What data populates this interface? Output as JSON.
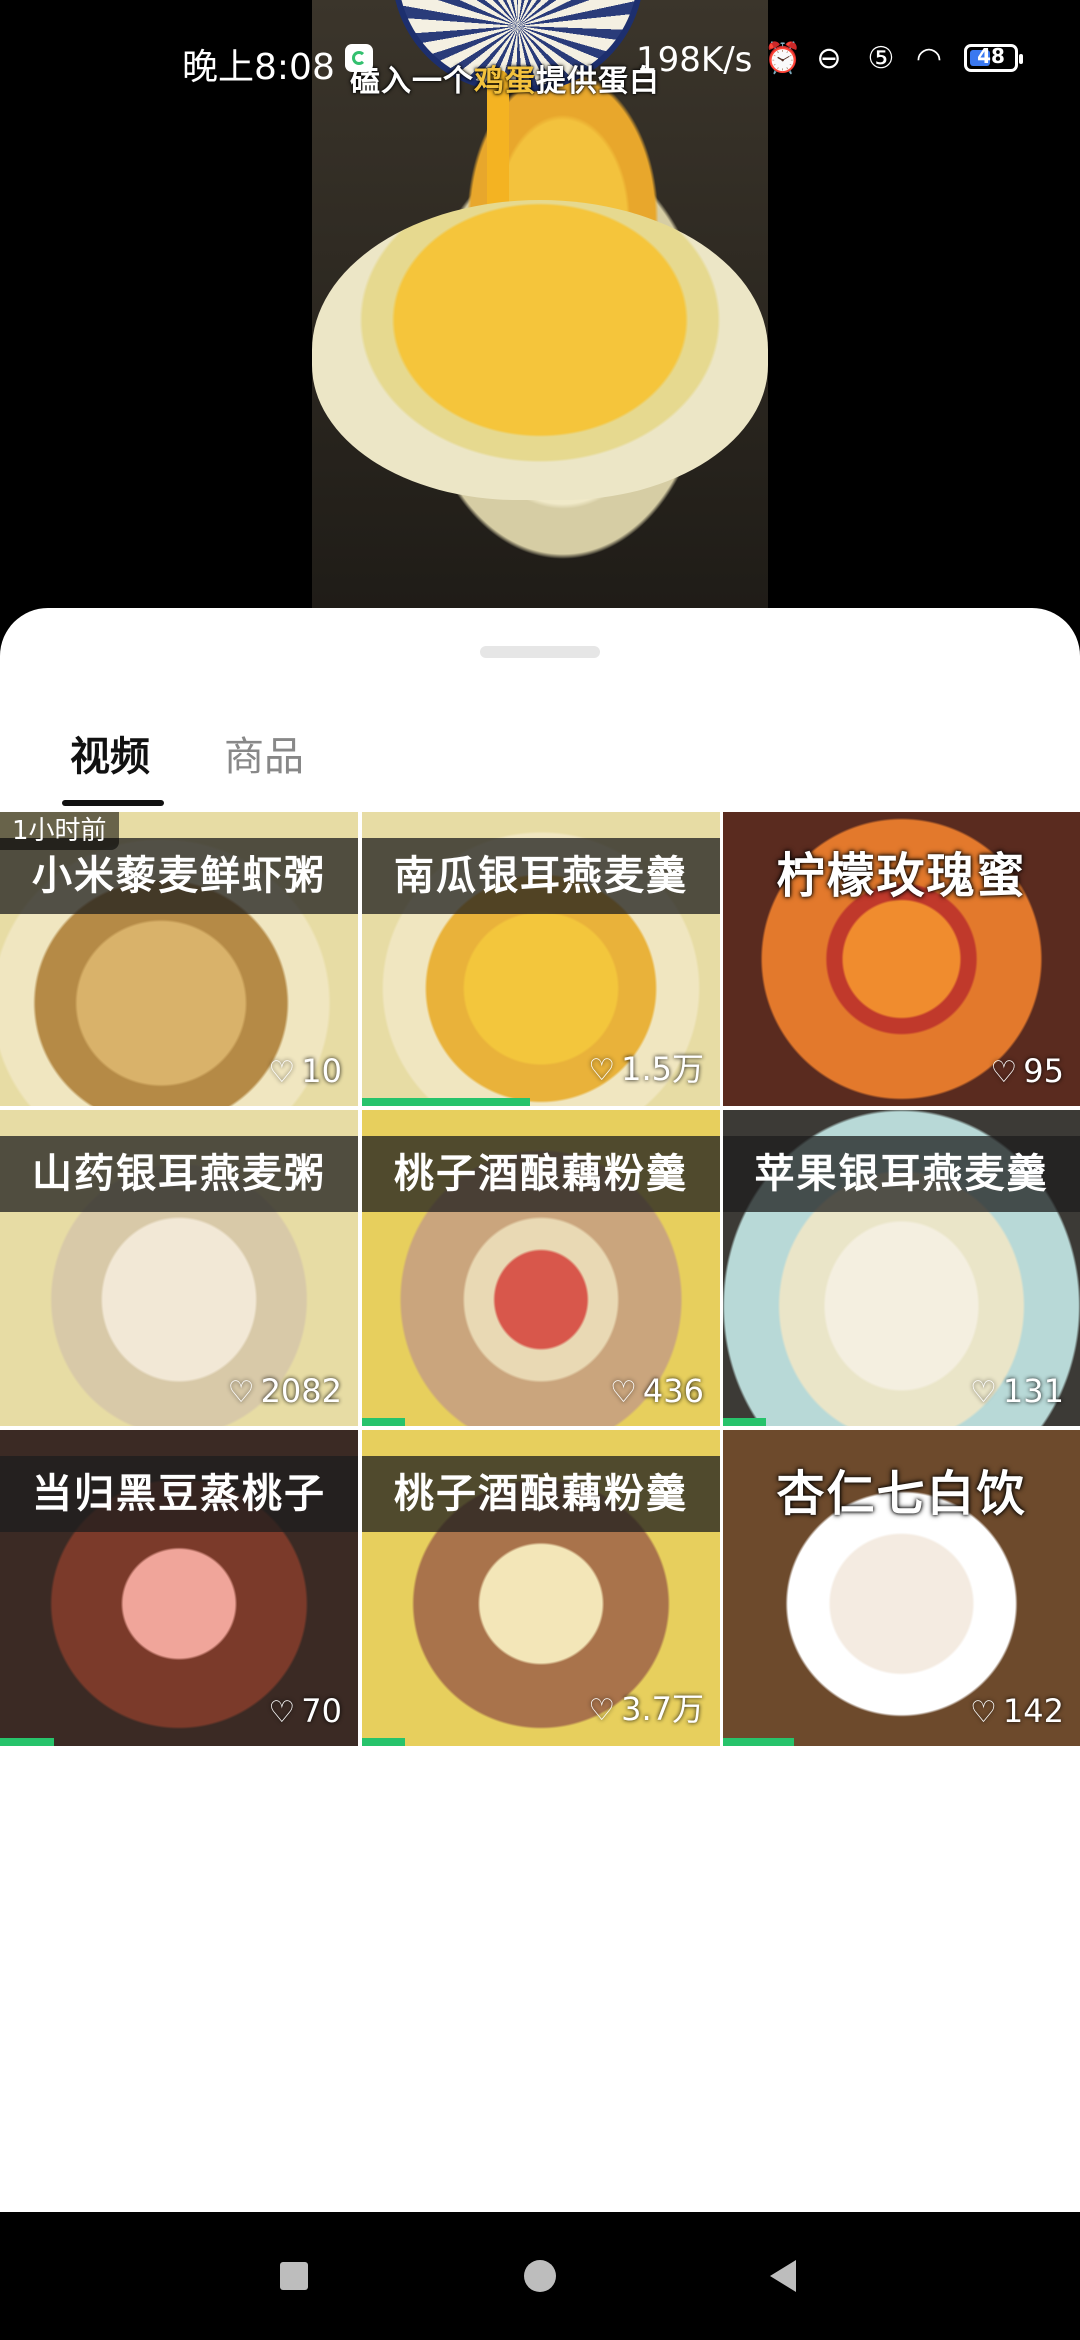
{
  "status_bar": {
    "time": "晚上8:08",
    "speed": "198K/s",
    "battery": "48",
    "icons": [
      "alarm-icon",
      "dnd-icon",
      "vpn-icon",
      "wifi-icon",
      "battery-icon"
    ]
  },
  "video": {
    "caption_prefix": "磕入一个",
    "caption_highlight": "鸡蛋",
    "caption_suffix": "提供蛋白"
  },
  "tabs": [
    {
      "label": "视频",
      "active": true
    },
    {
      "label": "商品",
      "active": false
    }
  ],
  "cards": [
    {
      "title": "小米藜麦鲜虾粥",
      "likes": "10",
      "badge": "1小时前",
      "progress": 0
    },
    {
      "title": "南瓜银耳燕麦羹",
      "likes": "1.5万",
      "progress": 0.47
    },
    {
      "title": "柠檬玫瑰蜜",
      "likes": "95",
      "progress": 0
    },
    {
      "title": "山药银耳燕麦粥",
      "likes": "2082",
      "progress": 0
    },
    {
      "title": "桃子酒酿藕粉羹",
      "likes": "436",
      "progress": 0.12
    },
    {
      "title": "苹果银耳燕麦羹",
      "likes": "131",
      "progress": 0.12
    },
    {
      "title": "当归黑豆蒸桃子",
      "likes": "70",
      "progress": 0.15
    },
    {
      "title": "桃子酒酿藕粉羹",
      "likes": "3.7万",
      "progress": 0.12
    },
    {
      "title": "杏仁七白饮",
      "likes": "142",
      "progress": 0.2
    }
  ],
  "colors": {
    "accent_green": "#27c36b",
    "sheet_background": "#ffffff",
    "active_tab": "#111111",
    "inactive_tab": "#888888"
  }
}
